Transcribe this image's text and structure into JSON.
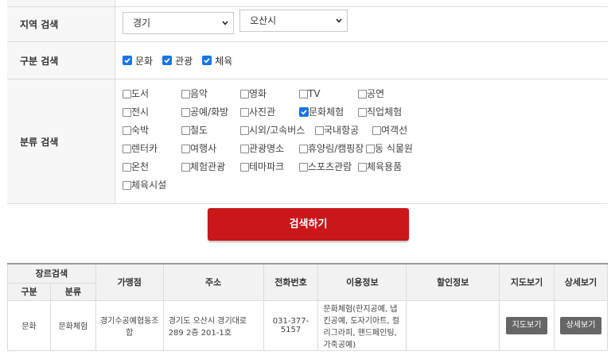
{
  "region": {
    "label": "지역 검색",
    "province": "경기",
    "city": "오산시"
  },
  "type": {
    "label": "구분 검색",
    "items": [
      "문화",
      "관광",
      "체육"
    ]
  },
  "category": {
    "label": "분류 검색",
    "items": [
      {
        "label": "도서",
        "checked": false
      },
      {
        "label": "음악",
        "checked": false
      },
      {
        "label": "영화",
        "checked": false
      },
      {
        "label": "TV",
        "checked": false
      },
      {
        "label": "공연",
        "checked": false
      },
      {
        "label": "전시",
        "checked": false
      },
      {
        "label": "공예/화방",
        "checked": false
      },
      {
        "label": "사진관",
        "checked": false
      },
      {
        "label": "문화체험",
        "checked": true
      },
      {
        "label": "직업체험",
        "checked": false
      },
      {
        "label": "숙박",
        "checked": false
      },
      {
        "label": "철도",
        "checked": false
      },
      {
        "label": "시외/고속버스",
        "checked": false
      },
      {
        "label": "국내항공",
        "checked": false
      },
      {
        "label": "여객선",
        "checked": false
      },
      {
        "label": "렌터카",
        "checked": false
      },
      {
        "label": "여행사",
        "checked": false
      },
      {
        "label": "관광명소",
        "checked": false
      },
      {
        "label": "휴양림/캠핑장",
        "checked": false
      },
      {
        "label": "동 식물원",
        "checked": false
      },
      {
        "label": "온천",
        "checked": false
      },
      {
        "label": "체험관광",
        "checked": false
      },
      {
        "label": "테마파크",
        "checked": false
      },
      {
        "label": "스포츠관람",
        "checked": false
      },
      {
        "label": "체육용품",
        "checked": false
      },
      {
        "label": "체육시설",
        "checked": false
      }
    ]
  },
  "search_button": "검색하기",
  "table": {
    "group_header": "장르검색",
    "headers": {
      "type": "구분",
      "category": "분류",
      "store": "가맹점",
      "address": "주소",
      "phone": "전화번호",
      "usage": "이용정보",
      "discount": "할인정보",
      "map": "지도보기",
      "detail": "상세보기"
    },
    "rows": [
      {
        "type": "문화",
        "category": "문화체험",
        "store": "경기수공예협동조합",
        "address": "경기도 오산시 경기대로 289 2층 201-1호",
        "phone": "031-377-5157",
        "usage": "문화체험(한지공예, 냅킨공예, 도자기아트, 컬리그라피, 핸드페인팅, 가죽공예)",
        "discount": "",
        "map_button": "지도보기",
        "detail_button": "상세보기"
      }
    ]
  },
  "colors": {
    "accent": "#1a73e8",
    "search_button": "#c9171a",
    "gray_button": "#666666"
  }
}
